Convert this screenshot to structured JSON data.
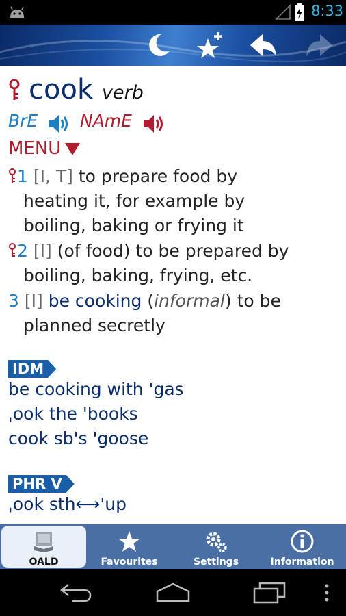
{
  "status_bar": {
    "time": "8:33"
  },
  "toolbar": {
    "night_mode_icon": "moon-icon",
    "add_favourite_icon": "star-plus-icon",
    "back_icon": "arrow-back-icon",
    "forward_icon": "arrow-forward-icon"
  },
  "entry": {
    "headword": "cook",
    "part_of_speech": "verb",
    "pron_bre": "BrE",
    "pron_name": "NAmE",
    "menu_label": "MENU",
    "senses": [
      {
        "num": "1",
        "grammar": "[I, T]",
        "lines": [
          "to prepare food by",
          "heating it, for example by",
          "boiling, baking or frying it"
        ]
      },
      {
        "num": "2",
        "grammar": "[I]",
        "lines": [
          "(of food) to be prepared by",
          "boiling, baking, frying, etc."
        ]
      },
      {
        "num": "3",
        "grammar": "[I]",
        "phrase": "be cooking",
        "register": "informal",
        "lines": [
          "to be",
          "planned secretly"
        ]
      }
    ],
    "idioms_label": "IDM",
    "idioms": [
      "be cooking with 'gas",
      "ˌook the 'books",
      "cook sb's 'goose"
    ],
    "phrasal_label": "PHR V",
    "phrasal_verbs": [
      "ˌook sth⟷'up"
    ]
  },
  "tabs": [
    {
      "label": "OALD",
      "icon": "book-icon",
      "active": true
    },
    {
      "label": "Favourites",
      "icon": "star-icon",
      "active": false
    },
    {
      "label": "Settings",
      "icon": "gears-icon",
      "active": false
    },
    {
      "label": "Information",
      "icon": "info-icon",
      "active": false
    }
  ],
  "colors": {
    "headword": "#0a2d6e",
    "sense_number": "#1a7fc4",
    "accent_red": "#b01c2e",
    "tab_bar": "#4a6fa5"
  }
}
